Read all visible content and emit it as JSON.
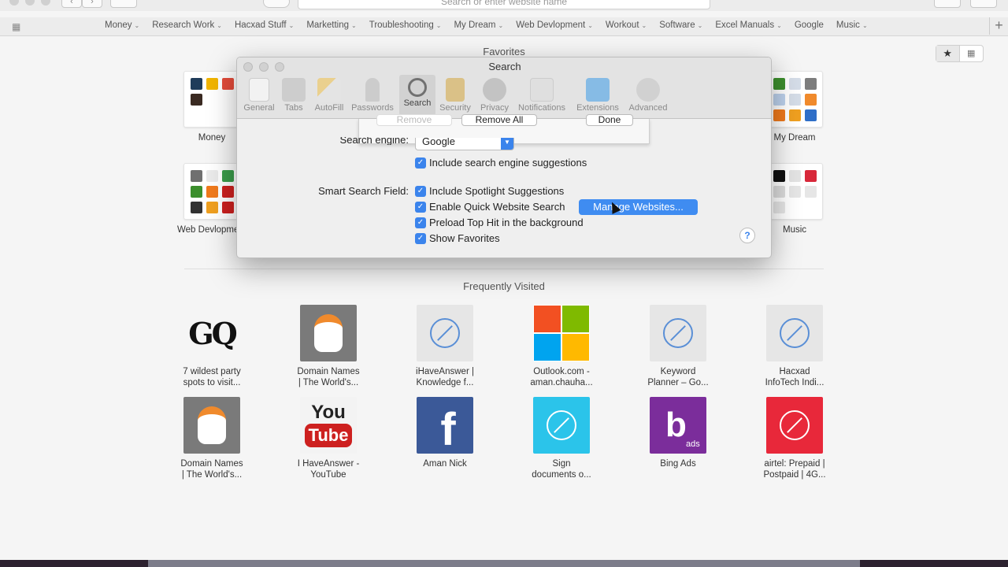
{
  "toolbar": {
    "address_placeholder": "Search or enter website name",
    "back_glyph": "‹",
    "forward_glyph": "›"
  },
  "bookmarks": {
    "items": [
      "Money",
      "Research Work",
      "Hacxad Stuff",
      "Marketting",
      "Troubleshooting",
      "My Dream",
      "Web Devlopment",
      "Workout",
      "Software",
      "Excel Manuals"
    ],
    "plain_items": [
      "Google",
      "Music"
    ],
    "caret": "⌄",
    "plus": "+"
  },
  "favorites": {
    "title": "Favorites",
    "tiles": [
      {
        "label": "Money"
      },
      {
        "label": "My Dream"
      },
      {
        "label": "Web Devlopment"
      },
      {
        "label": "Music"
      }
    ],
    "toggle_star": "★",
    "toggle_grid": "▦"
  },
  "frequent": {
    "title": "Frequently Visited",
    "row1": [
      {
        "label1": "7 wildest party",
        "label2": "spots to visit..."
      },
      {
        "label1": "Domain Names",
        "label2": "| The World's..."
      },
      {
        "label1": "iHaveAnswer |",
        "label2": "Knowledge f..."
      },
      {
        "label1": "Outlook.com -",
        "label2": "aman.chauha..."
      },
      {
        "label1": "Keyword",
        "label2": "Planner – Go..."
      },
      {
        "label1": "Hacxad",
        "label2": "InfoTech Indi..."
      }
    ],
    "row2": [
      {
        "label1": "Domain Names",
        "label2": "| The World's..."
      },
      {
        "label1": "I HaveAnswer -",
        "label2": "YouTube"
      },
      {
        "label1": "Aman Nick",
        "label2": ""
      },
      {
        "label1": "Sign",
        "label2": "documents o..."
      },
      {
        "label1": "Bing Ads",
        "label2": ""
      },
      {
        "label1": "airtel: Prepaid |",
        "label2": "Postpaid | 4G..."
      }
    ],
    "gq_text": "GQ",
    "youtube_you": "You",
    "youtube_tube": "Tube",
    "facebook_f": "f",
    "bing_ads": "ads"
  },
  "dialog": {
    "title": "Search",
    "tabs": [
      {
        "label": "General"
      },
      {
        "label": "Tabs"
      },
      {
        "label": "AutoFill"
      },
      {
        "label": "Passwords"
      },
      {
        "label": "Search"
      },
      {
        "label": "Security"
      },
      {
        "label": "Privacy"
      },
      {
        "label": "Notifications"
      },
      {
        "label": "Extensions"
      },
      {
        "label": "Advanced"
      }
    ],
    "sheet": {
      "remove": "Remove",
      "remove_all": "Remove All",
      "done": "Done"
    },
    "search_engine_label": "Search engine:",
    "search_engine_value": "Google",
    "include_suggestions": "Include search engine suggestions",
    "smart_field_label": "Smart Search Field:",
    "options": [
      "Include Spotlight Suggestions",
      "Enable Quick Website Search",
      "Preload Top Hit in the background",
      "Show Favorites"
    ],
    "manage_button": "Manage Websites...",
    "help": "?",
    "check_glyph": "✓"
  },
  "colors": {
    "accent": "#3b84ec",
    "youtube_red": "#cd201f",
    "facebook_blue": "#3b5998",
    "bing_purple": "#7b2d9b",
    "airtel_red": "#e8283a",
    "sign_cyan": "#2bc4ea"
  }
}
